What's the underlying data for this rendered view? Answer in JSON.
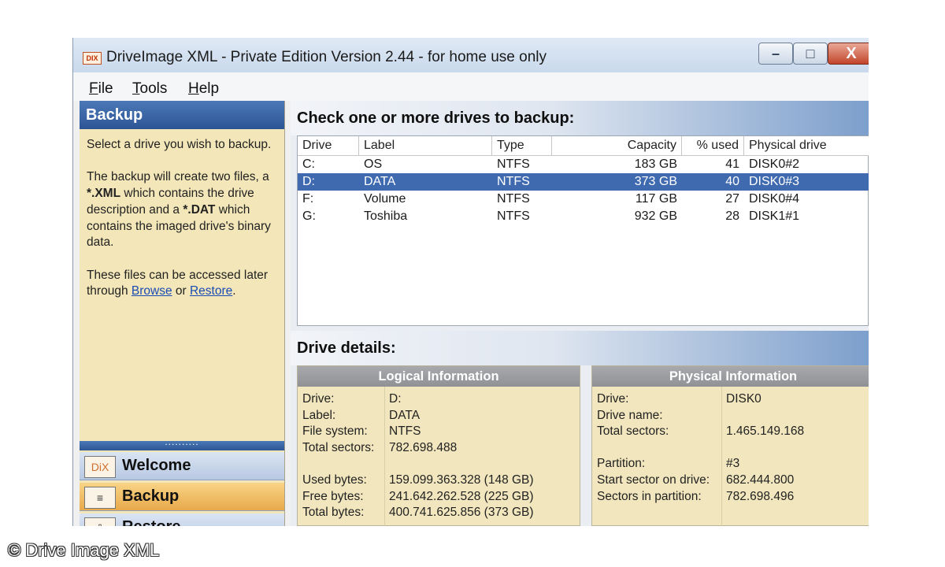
{
  "window": {
    "title": "DriveImage XML - Private Edition Version 2.44 - for home use only",
    "icon_label": "DIX",
    "controls": {
      "minimize": "–",
      "maximize": "□",
      "close": "X"
    }
  },
  "menu": [
    {
      "key": "F",
      "rest": "ile"
    },
    {
      "key": "T",
      "rest": "ools"
    },
    {
      "key": "H",
      "rest": "elp"
    }
  ],
  "sidebar": {
    "header": "Backup",
    "p1": "Select a drive you wish to backup.",
    "p2_a": "The backup will create two files, a ",
    "p2_xml": "*.XML",
    "p2_b": " which contains the drive description and a ",
    "p2_dat": "*.DAT",
    "p2_c": " which contains the imaged drive's binary data.",
    "p3_a": "These files can be accessed later through ",
    "link_browse": "Browse",
    "p3_or": " or ",
    "link_restore": "Restore",
    "p3_end": ".",
    "grip": "..........",
    "nav": [
      {
        "icon": "DiX",
        "label": "Welcome",
        "active": false
      },
      {
        "icon": "≡",
        "label": "Backup",
        "active": true
      },
      {
        "icon": "⇩",
        "label": "Restore",
        "active": false
      }
    ]
  },
  "drives": {
    "heading": "Check one or more drives to backup:",
    "columns": [
      "Drive",
      "Label",
      "Type",
      "Capacity",
      "% used",
      "Physical drive"
    ],
    "rows": [
      {
        "drive": "C:",
        "label": "OS",
        "type": "NTFS",
        "capacity": "183 GB",
        "used": "41",
        "physical": "DISK0#2",
        "selected": false
      },
      {
        "drive": "D:",
        "label": "DATA",
        "type": "NTFS",
        "capacity": "373 GB",
        "used": "40",
        "physical": "DISK0#3",
        "selected": true
      },
      {
        "drive": "F:",
        "label": "Volume",
        "type": "NTFS",
        "capacity": "117 GB",
        "used": "27",
        "physical": "DISK0#4",
        "selected": false
      },
      {
        "drive": "G:",
        "label": "Toshiba",
        "type": "NTFS",
        "capacity": "932 GB",
        "used": "28",
        "physical": "DISK1#1",
        "selected": false
      }
    ]
  },
  "details": {
    "heading": "Drive details:",
    "logical": {
      "title": "Logical Information",
      "labels": [
        "Drive:",
        "Label:",
        "File system:",
        "Total sectors:",
        "",
        "Used bytes:",
        "Free bytes:",
        "Total bytes:"
      ],
      "values": [
        "D:",
        "DATA",
        "NTFS",
        "782.698.488",
        "",
        "159.099.363.328 (148 GB)",
        "241.642.262.528 (225 GB)",
        "400.741.625.856 (373 GB)"
      ]
    },
    "physical": {
      "title": "Physical Information",
      "labels": [
        "Drive:",
        "Drive name:",
        "Total sectors:",
        "",
        "Partition:",
        "Start sector on drive:",
        "Sectors in partition:"
      ],
      "values": [
        "DISK0",
        "",
        "1.465.149.168",
        "",
        "#3",
        "682.444.800",
        "782.698.496"
      ]
    }
  },
  "credit": "© Drive Image XML",
  "colors": {
    "selection": "#3f6ab0",
    "sidebar_bg": "#f3e6b8",
    "header_blue": "#2c5596",
    "active_nav": "#e9a94b"
  }
}
